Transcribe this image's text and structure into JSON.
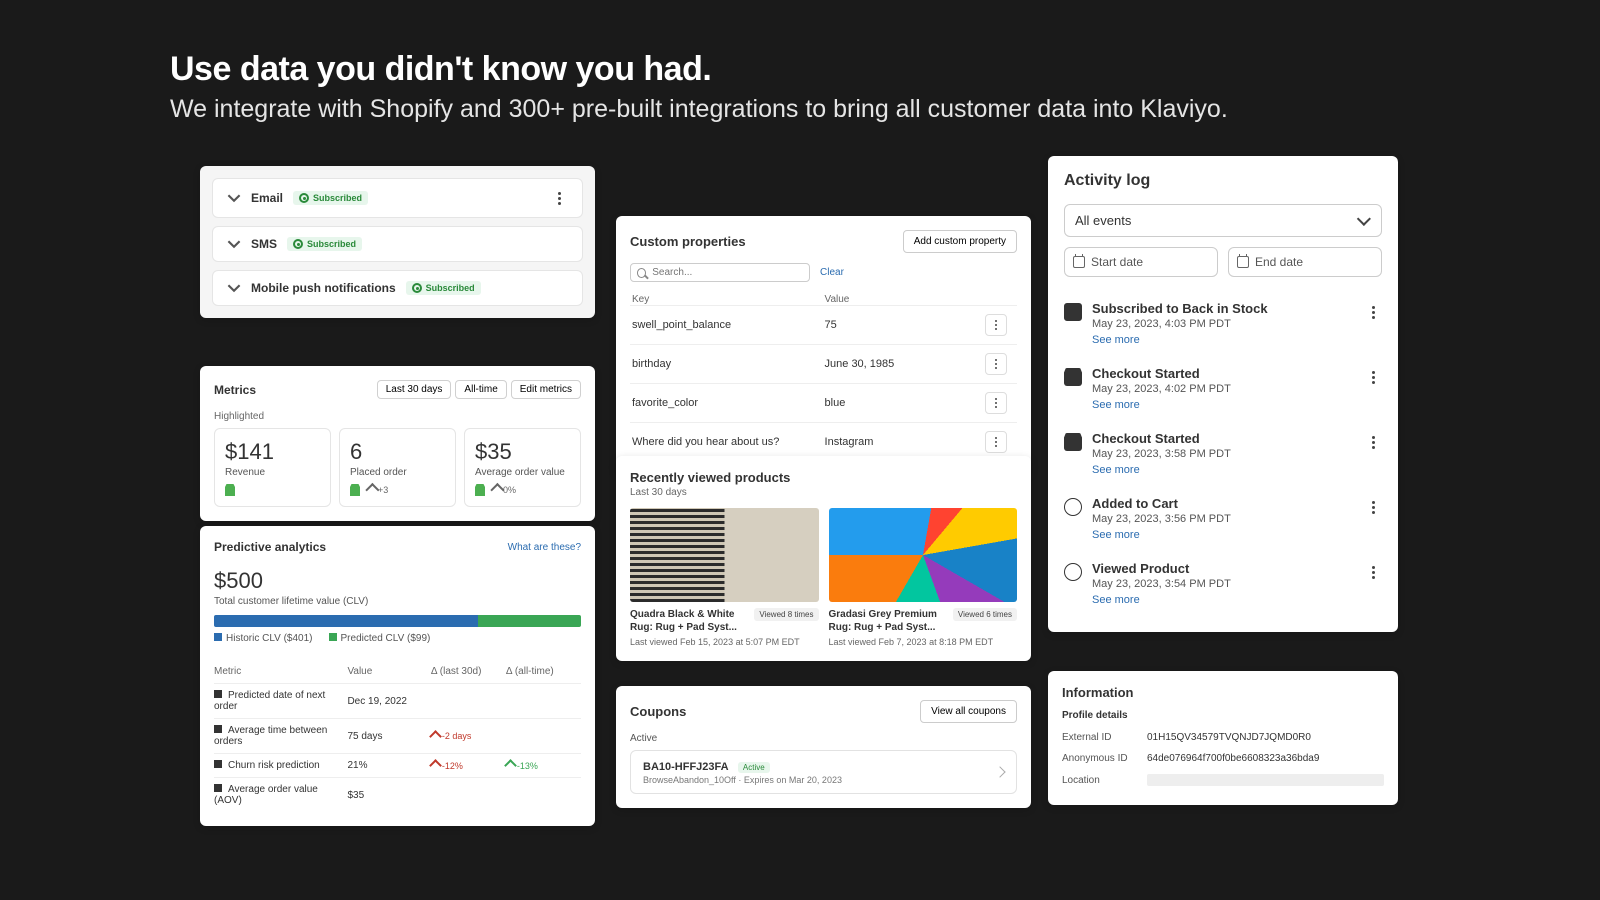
{
  "hero": {
    "title": "Use data you didn't know you had.",
    "subtitle": "We integrate with Shopify and 300+ pre-built integrations to bring all customer data into Klaviyo."
  },
  "channels": {
    "subscribed_label": "Subscribed",
    "items": [
      {
        "label": "Email"
      },
      {
        "label": "SMS"
      },
      {
        "label": "Mobile push notifications"
      }
    ]
  },
  "metrics": {
    "title": "Metrics",
    "tabs": {
      "t0": "Last 30 days",
      "t1": "All-time",
      "t2": "Edit metrics"
    },
    "highlighted_label": "Highlighted",
    "stats": [
      {
        "value": "$141",
        "label": "Revenue",
        "trend": ""
      },
      {
        "value": "6",
        "label": "Placed order",
        "trend": "+3"
      },
      {
        "value": "$35",
        "label": "Average order value",
        "trend": "0%"
      }
    ]
  },
  "predictive": {
    "title": "Predictive analytics",
    "link": "What are these?",
    "clv_value": "$500",
    "clv_label": "Total customer lifetime value (CLV)",
    "legend_hist": "Historic CLV ($401)",
    "legend_pred": "Predicted CLV ($99)",
    "cols": {
      "c0": "Metric",
      "c1": "Value",
      "c2": "Δ (last 30d)",
      "c3": "Δ (all-time)"
    },
    "rows": [
      {
        "metric": "Predicted date of next order",
        "value": "Dec 19, 2022",
        "d30": "",
        "dall": ""
      },
      {
        "metric": "Average time between orders",
        "value": "75 days",
        "d30": "-2 days",
        "dall": ""
      },
      {
        "metric": "Churn risk prediction",
        "value": "21%",
        "d30": "-12%",
        "dall": "-13%"
      },
      {
        "metric": "Average order value (AOV)",
        "value": "$35",
        "d30": "",
        "dall": ""
      }
    ]
  },
  "custom_props": {
    "title": "Custom properties",
    "add_btn": "Add custom property",
    "search_placeholder": "Search...",
    "clear": "Clear",
    "key_h": "Key",
    "val_h": "Value",
    "rows": [
      {
        "k": "swell_point_balance",
        "v": "75"
      },
      {
        "k": "birthday",
        "v": "June 30, 1985"
      },
      {
        "k": "favorite_color",
        "v": "blue"
      },
      {
        "k": "Where did you hear about us?",
        "v": "Instagram"
      }
    ]
  },
  "recent": {
    "title": "Recently viewed products",
    "sub": "Last 30 days",
    "items": [
      {
        "title": "Quadra Black & White Rug: Rug + Pad Syst...",
        "views": "Viewed 8 times",
        "meta": "Last viewed Feb 15, 2023 at 5:07 PM EDT"
      },
      {
        "title": "Gradasi Grey Premium Rug: Rug + Pad Syst...",
        "views": "Viewed 6 times",
        "meta": "Last viewed Feb 7, 2023 at 8:18 PM EDT"
      }
    ]
  },
  "coupons": {
    "title": "Coupons",
    "view_all": "View all coupons",
    "active_label": "Active",
    "active_badge": "Active",
    "code": "BA10-HFFJ23FA",
    "meta": "BrowseAbandon_10Off · Expires on Mar 20, 2023"
  },
  "activity": {
    "title": "Activity log",
    "filter": "All events",
    "start_ph": "Start date",
    "end_ph": "End date",
    "see_more": "See more",
    "events": [
      {
        "icon": "tag",
        "title": "Subscribed to Back in Stock",
        "ts": "May 23, 2023, 4:03 PM PDT"
      },
      {
        "icon": "shop",
        "title": "Checkout Started",
        "ts": "May 23, 2023, 4:02 PM PDT"
      },
      {
        "icon": "shop",
        "title": "Checkout Started",
        "ts": "May 23, 2023, 3:58 PM PDT"
      },
      {
        "icon": "gear",
        "title": "Added to Cart",
        "ts": "May 23, 2023, 3:56 PM PDT"
      },
      {
        "icon": "gear",
        "title": "Viewed Product",
        "ts": "May 23, 2023, 3:54 PM PDT"
      }
    ]
  },
  "information": {
    "title": "Information",
    "details_h": "Profile details",
    "labels": {
      "ext": "External ID",
      "anon": "Anonymous ID",
      "loc": "Location"
    },
    "external_id": "01H15QV34579TVQNJD7JQMD0R0",
    "anonymous_id": "64de076964f700f0be6608323a36bda9"
  }
}
